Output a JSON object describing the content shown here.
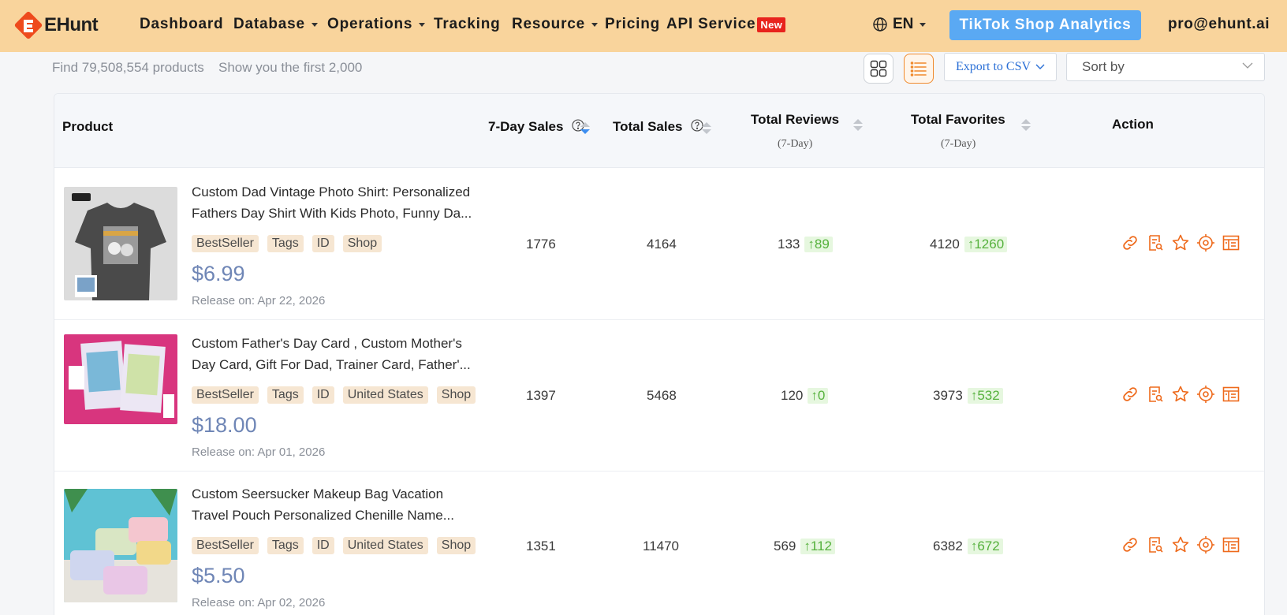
{
  "app": {
    "logo_text": "EHunt",
    "brand_color": "#ee6a1c",
    "accent_color": "#5aa9f3"
  },
  "nav": {
    "items": [
      {
        "label": "Dashboard"
      },
      {
        "label": "Database"
      },
      {
        "label": "Operations"
      },
      {
        "label": "Tracking"
      },
      {
        "label": "Resource"
      },
      {
        "label": "Pricing"
      },
      {
        "label": "API Service",
        "badge": "New"
      }
    ],
    "language": "EN",
    "cta": "TikTok Shop Analytics",
    "user": "pro@ehunt.ai"
  },
  "toolbar": {
    "found": "Find 79,508,554 products",
    "shown": "Show you the first 2,000",
    "export_label": "Export to CSV",
    "sort_placeholder": "Sort by",
    "active_view": "list"
  },
  "table": {
    "headers": {
      "product": "Product",
      "sales7": "7-Day Sales",
      "total_sales": "Total Sales",
      "reviews": "Total Reviews",
      "reviews_sub": "(7-Day)",
      "favorites": "Total Favorites",
      "favorites_sub": "(7-Day)",
      "action": "Action"
    },
    "rows": [
      {
        "title_line1": "Custom Dad Vintage Photo Shirt: Personalized",
        "title_line2": "Fathers Day Shirt With Kids Photo, Funny Da...",
        "tags": [
          "BestSeller",
          "Tags",
          "ID",
          "Shop"
        ],
        "price": "$6.99",
        "release": "Release on: Apr 22, 2026",
        "sales7": "1776",
        "total_sales": "4164",
        "reviews": "133",
        "reviews_growth": "↑89",
        "favorites": "4120",
        "favorites_growth": "↑1260"
      },
      {
        "title_line1": "Custom Father's Day Card , Custom Mother's",
        "title_line2": "Day Card, Gift For Dad, Trainer Card, Father'...",
        "tags": [
          "BestSeller",
          "Tags",
          "ID",
          "United States",
          "Shop"
        ],
        "price": "$18.00",
        "release": "Release on: Apr 01, 2026",
        "sales7": "1397",
        "total_sales": "5468",
        "reviews": "120",
        "reviews_growth": "↑0",
        "favorites": "3973",
        "favorites_growth": "↑532"
      },
      {
        "title_line1": "Custom Seersucker Makeup Bag Vacation",
        "title_line2": "Travel Pouch Personalized Chenille Name...",
        "tags": [
          "BestSeller",
          "Tags",
          "ID",
          "United States",
          "Shop"
        ],
        "price": "$5.50",
        "release": "Release on: Apr 02, 2026",
        "sales7": "1351",
        "total_sales": "11470",
        "reviews": "569",
        "reviews_growth": "↑112",
        "favorites": "6382",
        "favorites_growth": "↑672"
      }
    ],
    "action_icons": [
      "link-icon",
      "search-report-icon",
      "star-icon",
      "target-icon",
      "calendar-table-icon"
    ]
  }
}
